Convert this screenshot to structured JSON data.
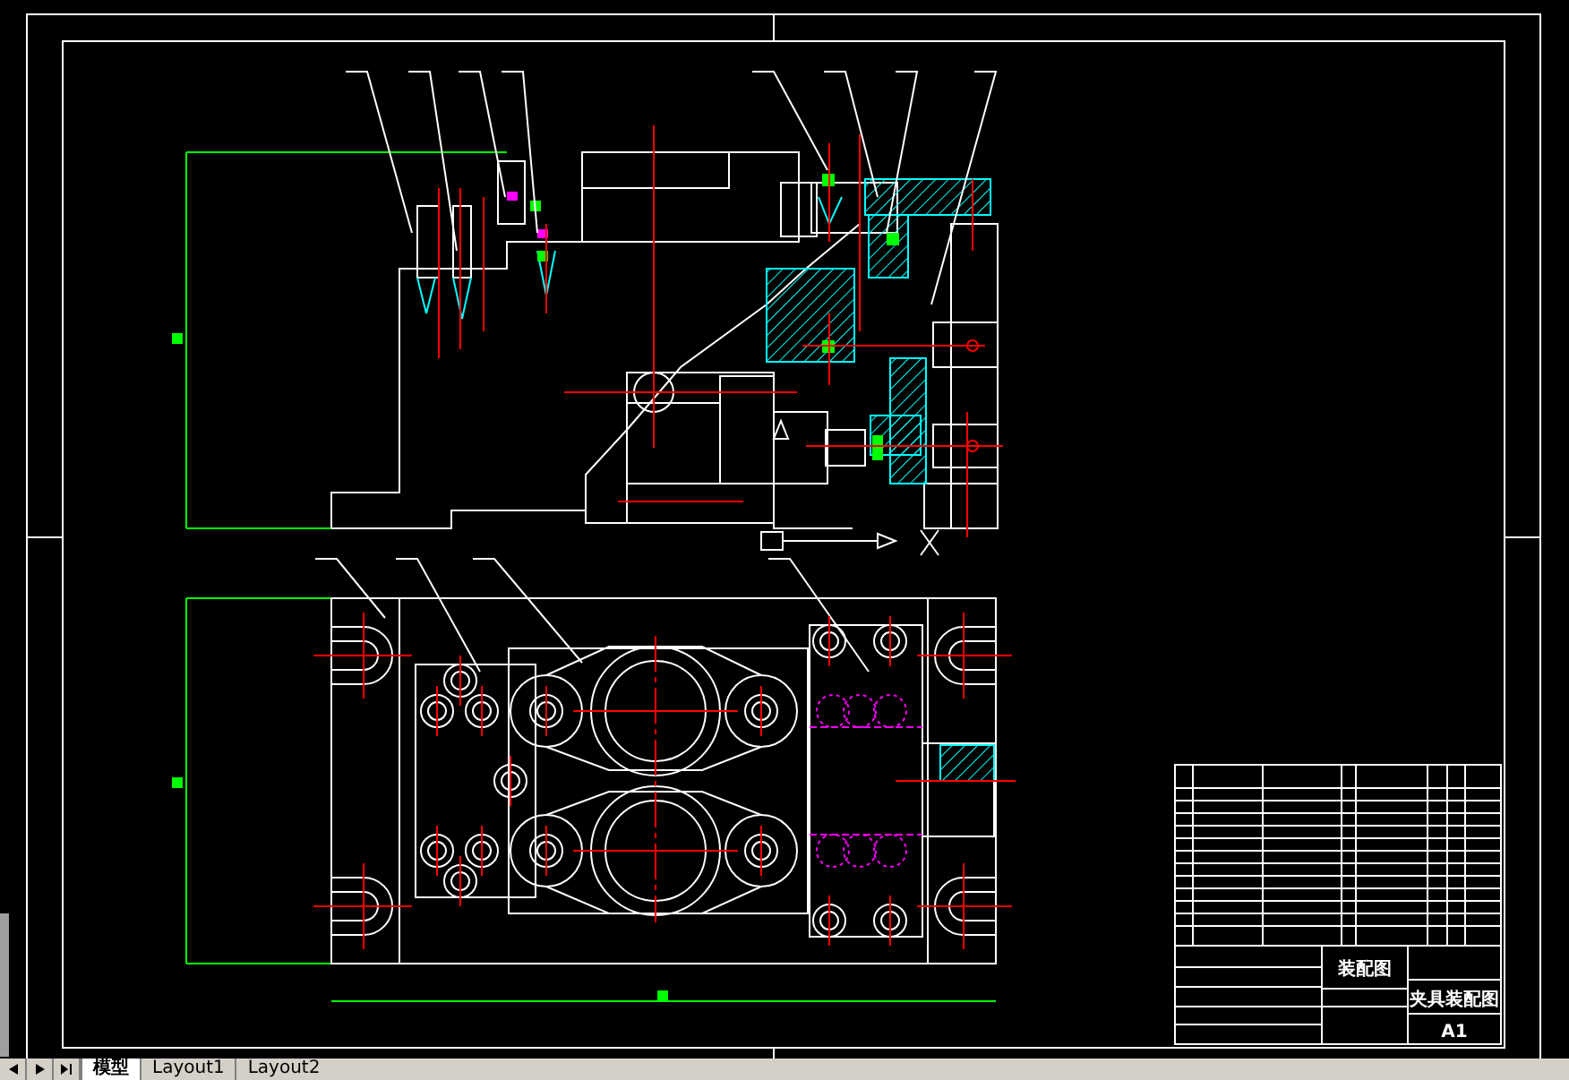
{
  "drawing": {
    "title_block": {
      "drawing_name": "装配图",
      "title": "夹具装配图",
      "sheet_size": "A1"
    }
  },
  "layout_tabs": [
    {
      "label": "模型",
      "selected": true
    },
    {
      "label": "Layout1",
      "selected": false
    },
    {
      "label": "Layout2",
      "selected": false
    }
  ]
}
